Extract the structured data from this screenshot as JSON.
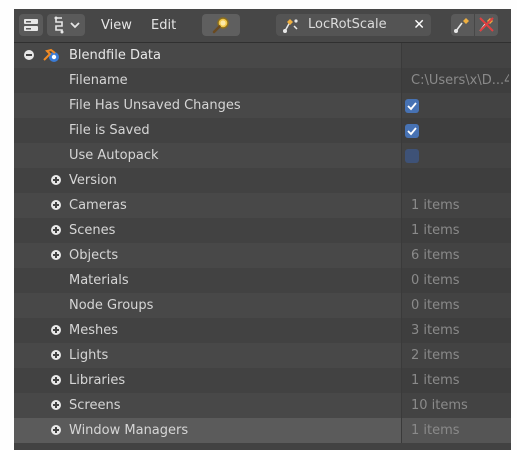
{
  "header": {
    "menu_view": "View",
    "menu_edit": "Edit",
    "keying_set": "LocRotScale",
    "clear_symbol": "✕",
    "icons": {
      "editor": "outliner-editor-icon",
      "display": "display-mode-icon",
      "chevron": "chevron-down-icon",
      "search": "search-icon",
      "keying": "keying-set-icon",
      "insert": "insert-keyframe-icon",
      "delete": "delete-keyframe-icon"
    }
  },
  "tree": {
    "root": {
      "label": "Blendfile Data",
      "icon": "blender-icon"
    },
    "properties": [
      {
        "label": "Filename",
        "value": "C:\\Users\\x\\D...4"
      },
      {
        "label": "File Has Unsaved Changes",
        "checked": true
      },
      {
        "label": "File is Saved",
        "checked": true
      },
      {
        "label": "Use Autopack",
        "checked": false
      }
    ],
    "collections": [
      {
        "label": "Version",
        "expandable": true,
        "value": ""
      },
      {
        "label": "Cameras",
        "expandable": true,
        "value": "1 items"
      },
      {
        "label": "Scenes",
        "expandable": true,
        "value": "1 items"
      },
      {
        "label": "Objects",
        "expandable": true,
        "value": "6 items"
      },
      {
        "label": "Materials",
        "expandable": false,
        "value": "0 items"
      },
      {
        "label": "Node Groups",
        "expandable": false,
        "value": "0 items"
      },
      {
        "label": "Meshes",
        "expandable": true,
        "value": "3 items"
      },
      {
        "label": "Lights",
        "expandable": true,
        "value": "2 items"
      },
      {
        "label": "Libraries",
        "expandable": true,
        "value": "1 items"
      },
      {
        "label": "Screens",
        "expandable": true,
        "value": "10 items"
      },
      {
        "label": "Window Managers",
        "expandable": true,
        "value": "1 items"
      }
    ]
  },
  "colors": {
    "panel_bg": "#424242",
    "row_alt": "#484848",
    "checkbox_on": "#4772b3",
    "text": "#d6d6d6",
    "value_text": "#8a8a8a"
  }
}
